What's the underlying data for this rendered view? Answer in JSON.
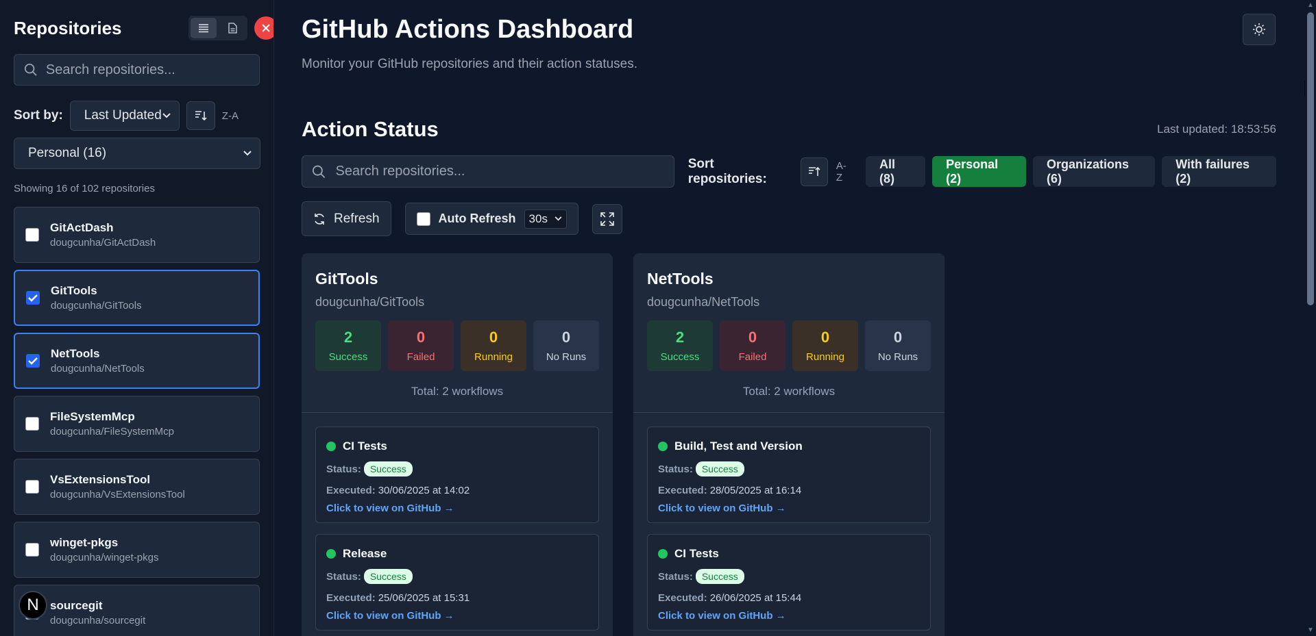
{
  "sidebar": {
    "title": "Repositories",
    "search_placeholder": "Search repositories...",
    "sort_label": "Sort by:",
    "sort_value": "Last Updated",
    "sort_dir": "Z-A",
    "filter_value": "Personal (16)",
    "showing": "Showing 16 of 102 repositories",
    "repos": [
      {
        "name": "GitActDash",
        "full": "dougcunha/GitActDash",
        "checked": false
      },
      {
        "name": "GitTools",
        "full": "dougcunha/GitTools",
        "checked": true
      },
      {
        "name": "NetTools",
        "full": "dougcunha/NetTools",
        "checked": true
      },
      {
        "name": "FileSystemMcp",
        "full": "dougcunha/FileSystemMcp",
        "checked": false
      },
      {
        "name": "VsExtensionsTool",
        "full": "dougcunha/VsExtensionsTool",
        "checked": false
      },
      {
        "name": "winget-pkgs",
        "full": "dougcunha/winget-pkgs",
        "checked": false
      },
      {
        "name": "sourcegit",
        "full": "dougcunha/sourcegit",
        "checked": false
      }
    ],
    "badge": "N"
  },
  "main": {
    "title": "GitHub Actions Dashboard",
    "subtitle": "Monitor your GitHub repositories and their action statuses.",
    "section_title": "Action Status",
    "last_updated": "Last updated: 18:53:56",
    "search_placeholder": "Search repositories...",
    "sort_label": "Sort repositories:",
    "sort_dir": "A-Z",
    "filters": [
      {
        "label": "All (8)",
        "active": false
      },
      {
        "label": "Personal (2)",
        "active": true
      },
      {
        "label": "Organizations (6)",
        "active": false
      },
      {
        "label": "With failures (2)",
        "active": false
      }
    ],
    "refresh_label": "Refresh",
    "auto_refresh_label": "Auto Refresh",
    "interval": "30s"
  },
  "cards": [
    {
      "name": "GitTools",
      "full": "dougcunha/GitTools",
      "success": "2",
      "failed": "0",
      "running": "0",
      "no_runs": "0",
      "total": "Total: 2 workflows",
      "workflows": [
        {
          "name": "CI Tests",
          "status": "Success",
          "executed": "30/06/2025 at 14:02",
          "link": "Click to view on GitHub →"
        },
        {
          "name": "Release",
          "status": "Success",
          "executed": "25/06/2025 at 15:31",
          "link": "Click to view on GitHub →"
        }
      ]
    },
    {
      "name": "NetTools",
      "full": "dougcunha/NetTools",
      "success": "2",
      "failed": "0",
      "running": "0",
      "no_runs": "0",
      "total": "Total: 2 workflows",
      "workflows": [
        {
          "name": "Build, Test and Version",
          "status": "Success",
          "executed": "28/05/2025 at 16:14",
          "link": "Click to view on GitHub →"
        },
        {
          "name": "CI Tests",
          "status": "Success",
          "executed": "26/06/2025 at 15:44",
          "link": "Click to view on GitHub →"
        }
      ]
    }
  ],
  "labels": {
    "success": "Success",
    "failed": "Failed",
    "running": "Running",
    "no_runs": "No Runs",
    "status": "Status:",
    "executed": "Executed:"
  },
  "colors": {
    "accent": "#15803d",
    "success": "#22c55e",
    "link": "#60a5fa",
    "danger": "#ef4444"
  }
}
